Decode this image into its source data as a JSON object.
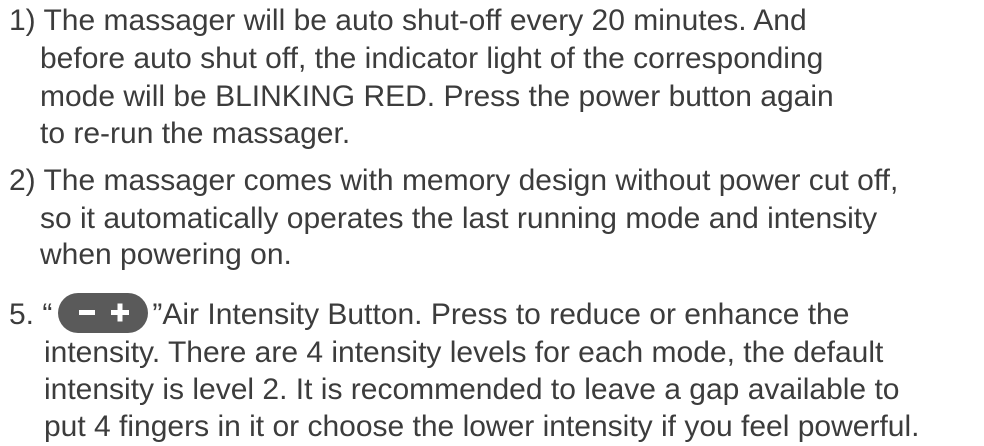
{
  "items": [
    {
      "marker": "1)",
      "lines": [
        "The massager will be auto shut-off every 20 minutes. And",
        "before auto shut off, the indicator light of the corresponding",
        "mode will be BLINKING RED. Press the power button again",
        "to re-run the massager."
      ]
    },
    {
      "marker": "2)",
      "lines": [
        "The massager comes with memory design without power cut off,",
        "so it automatically operates the last running mode and intensity",
        "when powering on."
      ]
    }
  ],
  "section5": {
    "marker": "5.",
    "open_quote": "“",
    "close_quote_text": "”Air Intensity Button. Press to reduce or enhance the",
    "button_icon": "minus-plus-pill-icon",
    "lines": [
      "intensity. There are 4 intensity levels for each mode, the default",
      "intensity is level 2. It is recommended to leave a gap available to",
      "put 4 fingers in it or choose the lower intensity if you feel powerful."
    ]
  },
  "colors": {
    "text": "#3c3c3c",
    "button": "#5a5a5a"
  }
}
